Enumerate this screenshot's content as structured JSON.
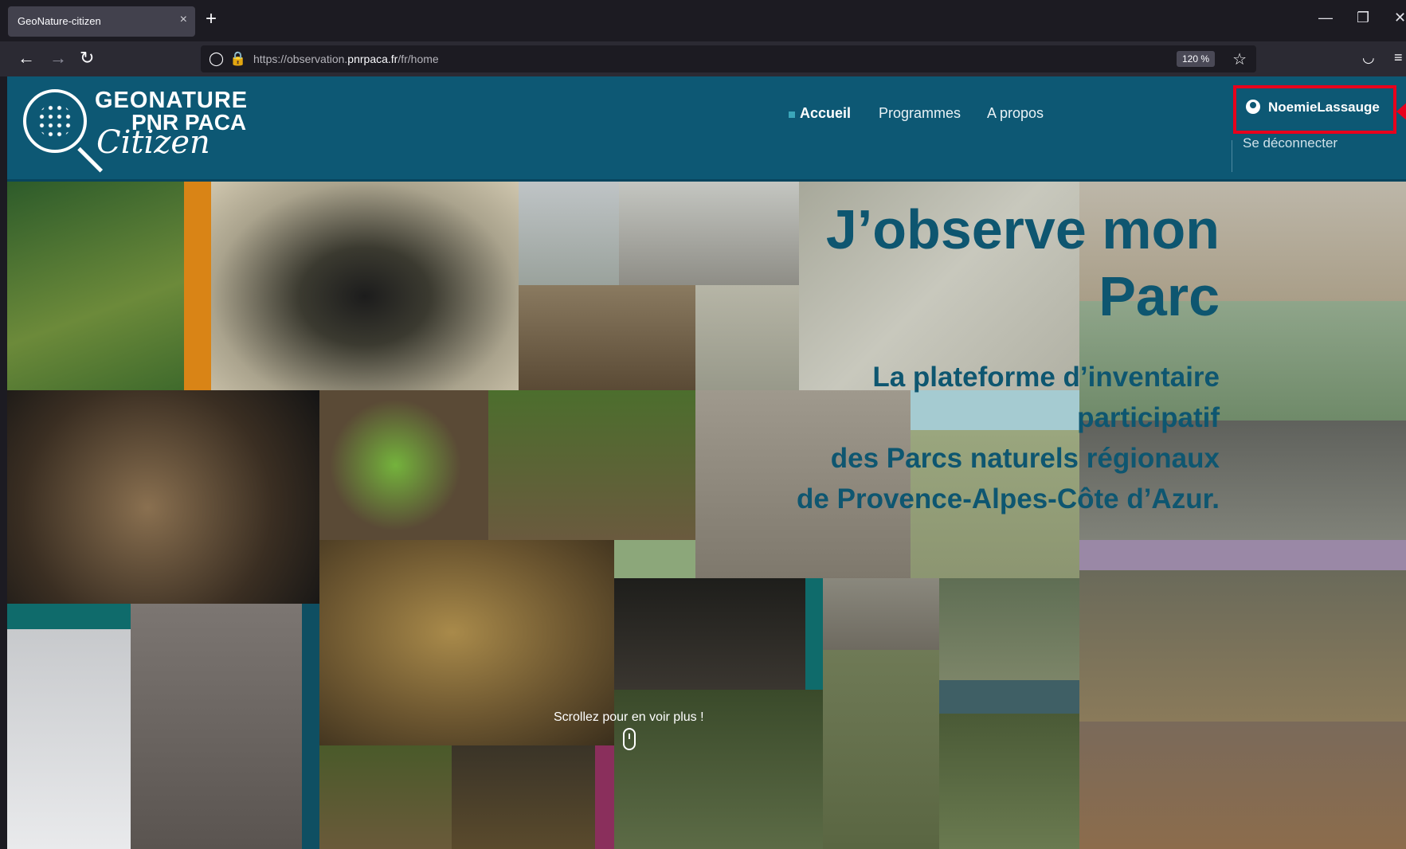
{
  "browser": {
    "tab_title": "GeoNature-citizen",
    "tab_close": "×",
    "new_tab": "+",
    "url_plain_before": "https://observation.",
    "url_domain": "pnrpaca.fr",
    "url_plain_after": "/fr/home",
    "zoom": "120 %"
  },
  "header": {
    "logo_line1": "GEONATURE",
    "logo_line2": "PNR PACA",
    "logo_line3": "Citizen",
    "nav": [
      "Accueil",
      "Programmes",
      "A propos"
    ],
    "user_name": "NoemieLassauge",
    "logout": "Se déconnecter"
  },
  "hero": {
    "title_line1": "J’observe mon",
    "title_line2": "Parc",
    "sub_line1": "La plateforme d’inventaire",
    "sub_line2": "participatif",
    "sub_line3": "des Parcs naturels régionaux",
    "sub_line4": "de Provence-Alpes-Côte d’Azur."
  },
  "scroll_hint": "Scrollez pour en voir plus !",
  "colors": {
    "header_bg": "#0d5874",
    "highlight_box": "#e8001c",
    "hero_text": "#0e5670"
  }
}
